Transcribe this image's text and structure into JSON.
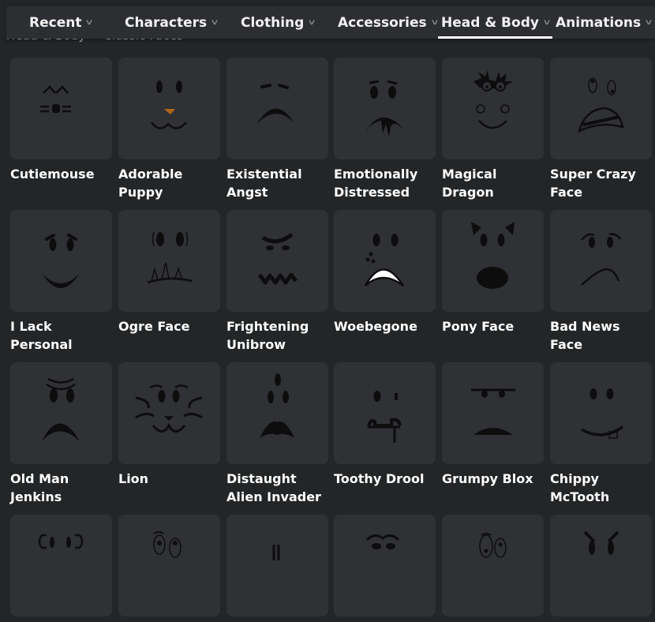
{
  "nav": {
    "tabs": [
      {
        "label": "Recent",
        "active": false
      },
      {
        "label": "Characters",
        "active": false
      },
      {
        "label": "Clothing",
        "active": false
      },
      {
        "label": "Accessories",
        "active": false
      },
      {
        "label": "Head & Body",
        "active": true
      },
      {
        "label": "Animations",
        "active": false
      }
    ],
    "chevron_icon": "chevron-down-icon"
  },
  "breadcrumb": "Head & Body > Classic Faces",
  "items": [
    {
      "name": "Cutiemouse",
      "icon": "cutiemouse-face"
    },
    {
      "name": "Adorable Puppy",
      "icon": "adorable-puppy-face"
    },
    {
      "name": "Existential Angst",
      "icon": "existential-angst-face"
    },
    {
      "name": "Emotionally Distressed",
      "icon": "emotionally-distressed-face"
    },
    {
      "name": "Magical Dragon",
      "icon": "magical-dragon-face"
    },
    {
      "name": "Super Crazy Face",
      "icon": "super-crazy-face"
    },
    {
      "name": "I Lack Personal",
      "icon": "i-lack-personal-face"
    },
    {
      "name": "Ogre Face",
      "icon": "ogre-face"
    },
    {
      "name": "Frightening Unibrow",
      "icon": "frightening-unibrow-face"
    },
    {
      "name": "Woebegone",
      "icon": "woebegone-face"
    },
    {
      "name": "Pony Face",
      "icon": "pony-face"
    },
    {
      "name": "Bad News Face",
      "icon": "bad-news-face"
    },
    {
      "name": "Old Man Jenkins",
      "icon": "old-man-jenkins-face"
    },
    {
      "name": "Lion",
      "icon": "lion-face"
    },
    {
      "name": "Distaught Alien Invader",
      "icon": "distaught-alien-invader-face"
    },
    {
      "name": "Toothy Drool",
      "icon": "toothy-drool-face"
    },
    {
      "name": "Grumpy Blox",
      "icon": "grumpy-blox-face"
    },
    {
      "name": "Chippy McTooth",
      "icon": "chippy-mctooth-face"
    },
    {
      "name": "",
      "icon": "bracket-eyes-face"
    },
    {
      "name": "",
      "icon": "outlined-eyes-face"
    },
    {
      "name": "",
      "icon": "line-mouth-face"
    },
    {
      "name": "",
      "icon": "arched-brow-face"
    },
    {
      "name": "",
      "icon": "wide-outlined-eyes-face"
    },
    {
      "name": "",
      "icon": "angry-brow-face"
    }
  ],
  "colors": {
    "background": "#232527",
    "tabbar": "#2d2e31",
    "tile": "#303135",
    "text": "#ffffff",
    "active_underline": "#ffffff",
    "puppy_nose": "#b0651c"
  }
}
